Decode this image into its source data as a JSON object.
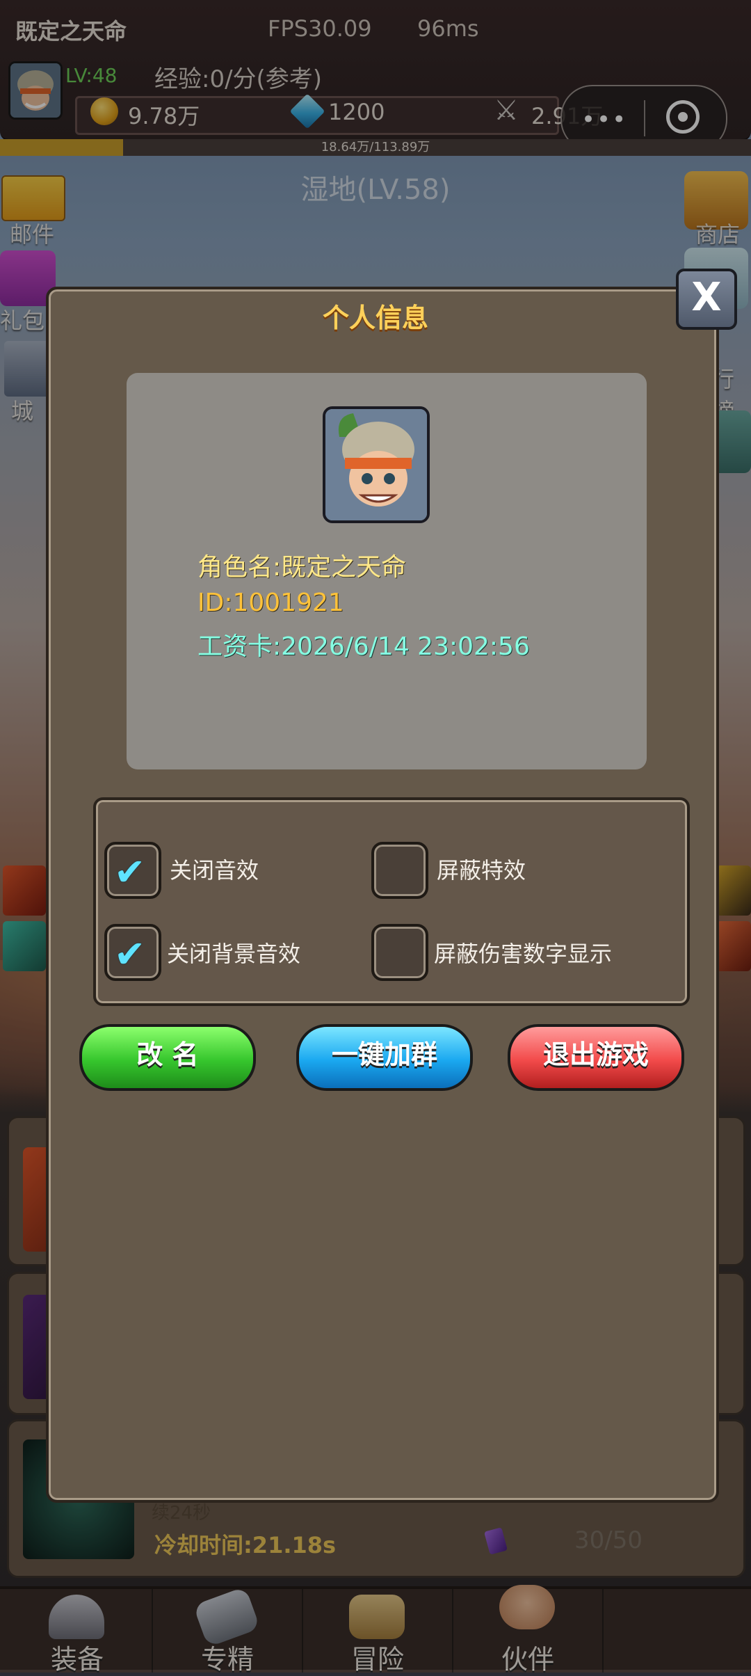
{
  "status": {
    "player_name": "既定之天命",
    "fps": "FPS30.09",
    "ping": "96ms",
    "level": "LV:48",
    "exp": "经验:0/分(参考)",
    "gold": "9.78万",
    "gems": "1200",
    "power": "2.91万",
    "hp_text": "18.64万/113.89万",
    "hp_fraction": 0.164,
    "map_name": "湿地(LV.58)"
  },
  "side_icons": {
    "left": [
      "邮件",
      "礼包",
      "城"
    ],
    "right": [
      "商店",
      "行榜"
    ]
  },
  "background_card": {
    "cont_text": "续24秒",
    "cooldown": "冷却时间:21.18s",
    "count": "30/50"
  },
  "modal": {
    "title": "个人信息",
    "close_label": "X",
    "role_name": "角色名:既定之天命",
    "id": "ID:1001921",
    "salary": "工资卡:2026/6/14 23:02:56",
    "settings": [
      {
        "label": "关闭音效",
        "checked": true
      },
      {
        "label": "屏蔽特效",
        "checked": false
      },
      {
        "label": "关闭背景音效",
        "checked": true
      },
      {
        "label": "屏蔽伤害数字显示",
        "checked": false
      }
    ],
    "buttons": {
      "rename": "改 名",
      "join_group": "一键加群",
      "exit": "退出游戏"
    }
  },
  "nav": [
    "装备",
    "专精",
    "冒险",
    "伙伴"
  ],
  "colors": {
    "title": "#ffd15a",
    "id": "#ffc23a",
    "salary": "#86ffe3",
    "check": "#5fe3ff"
  },
  "check_glyph": "✔"
}
